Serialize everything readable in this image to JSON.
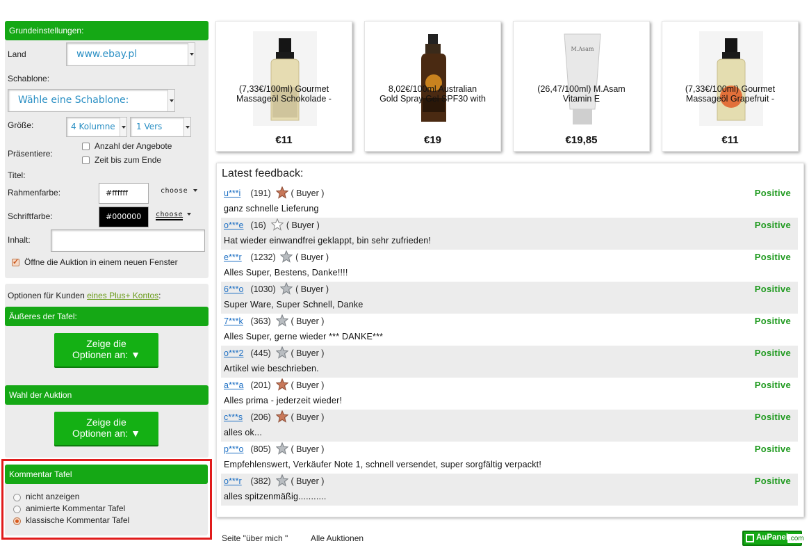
{
  "settings": {
    "header": "Grundeinstellungen:",
    "land_label": "Land",
    "land_value": "www.ebay.pl",
    "template_label": "Schablone:",
    "template_value": "Wähle eine Schablone:",
    "size_label": "Größe:",
    "columns_value": "4 Kolumne",
    "rows_value": "1 Vers",
    "present_label": "Präsentiere:",
    "opt_count": "Anzahl der Angebote",
    "opt_time": "Zeit bis zum Ende",
    "title_label": "Titel:",
    "frame_color_label": "Rahmenfarbe:",
    "frame_color_value": "#ffffff",
    "font_color_label": "Schriftfarbe:",
    "font_color_value": "#000000",
    "choose_label": "choose",
    "content_label": "Inhalt:",
    "open_new_window": "Öffne die Auktion in einem neuen Fenster"
  },
  "plus": {
    "text": "Optionen für Kunden ",
    "link": "eines Plus+ Kontos",
    "suffix": ":"
  },
  "outer": {
    "header": "Äußeres der Tafel:",
    "button_line1": "Zeige die",
    "button_line2": "Optionen an: ▼"
  },
  "auction": {
    "header": "Wahl der Auktion",
    "button_line1": "Zeige die",
    "button_line2": "Optionen an: ▼"
  },
  "comment_board": {
    "header": "Kommentar Tafel",
    "options": [
      "nicht anzeigen",
      "animierte Kommentar Tafel",
      "klassische Kommentar Tafel"
    ],
    "selected": "klassische Kommentar Tafel"
  },
  "products": [
    {
      "title_line1": "(7,33€/100ml) Gourmet",
      "title_line2": "Massageöl Schokolade -",
      "price": "€11"
    },
    {
      "title_line1": "8,02€/100ml Australian",
      "title_line2": "Gold Spray Gel SPF30 with",
      "price": "€19"
    },
    {
      "title_line1": "(26,47/100ml) M.Asam",
      "title_line2": "Vitamin E",
      "price": "€19,85"
    },
    {
      "title_line1": "(7,33€/100ml) Gourmet",
      "title_line2": "Massageöl Grapefruit -",
      "price": "€11"
    }
  ],
  "feedback": {
    "title": "Latest feedback:",
    "items": [
      {
        "user": "u***i",
        "count": "(191)",
        "star": "brown",
        "role": "( Buyer )",
        "status": "Positive",
        "comment": "ganz schnelle Lieferung"
      },
      {
        "user": "o***e",
        "count": "(16)",
        "star": "outline",
        "role": "( Buyer )",
        "status": "Positive",
        "comment": "Hat wieder einwandfrei geklappt, bin sehr zufrieden!"
      },
      {
        "user": "e***r",
        "count": "(1232)",
        "star": "silver",
        "role": "( Buyer )",
        "status": "Positive",
        "comment": "Alles Super, Bestens, Danke!!!!"
      },
      {
        "user": "6***o",
        "count": "(1030)",
        "star": "silver",
        "role": "( Buyer )",
        "status": "Positive",
        "comment": "Super Ware, Super Schnell, Danke"
      },
      {
        "user": "7***k",
        "count": "(363)",
        "star": "silver",
        "role": "( Buyer )",
        "status": "Positive",
        "comment": "Alles  Super, gerne wieder *** DANKE***"
      },
      {
        "user": "o***2",
        "count": "(445)",
        "star": "silver",
        "role": "( Buyer )",
        "status": "Positive",
        "comment": "Artikel wie beschrieben."
      },
      {
        "user": "a***a",
        "count": "(201)",
        "star": "brown",
        "role": "( Buyer )",
        "status": "Positive",
        "comment": "Alles prima - jederzeit wieder!"
      },
      {
        "user": "c***s",
        "count": "(206)",
        "star": "brown",
        "role": "( Buyer )",
        "status": "Positive",
        "comment": "alles ok..."
      },
      {
        "user": "p***o",
        "count": "(805)",
        "star": "silver",
        "role": "( Buyer )",
        "status": "Positive",
        "comment": "Empfehlenswert, Verkäufer Note 1, schnell versendet, super sorgfältig verpackt!"
      },
      {
        "user": "o***r",
        "count": "(382)",
        "star": "silver",
        "role": "( Buyer )",
        "status": "Positive",
        "comment": "alles spitzenmäßig..........."
      }
    ]
  },
  "footer": {
    "about": "Seite \"über mich \"",
    "all_auctions": "Alle Auktionen",
    "logo_text": "AuPanel",
    "logo_suffix": ".com"
  },
  "colors": {
    "accent_green": "#15a815",
    "positive_green": "#1f9a1f",
    "link_blue": "#1d6fc3",
    "highlight_red": "#e01b1b"
  }
}
